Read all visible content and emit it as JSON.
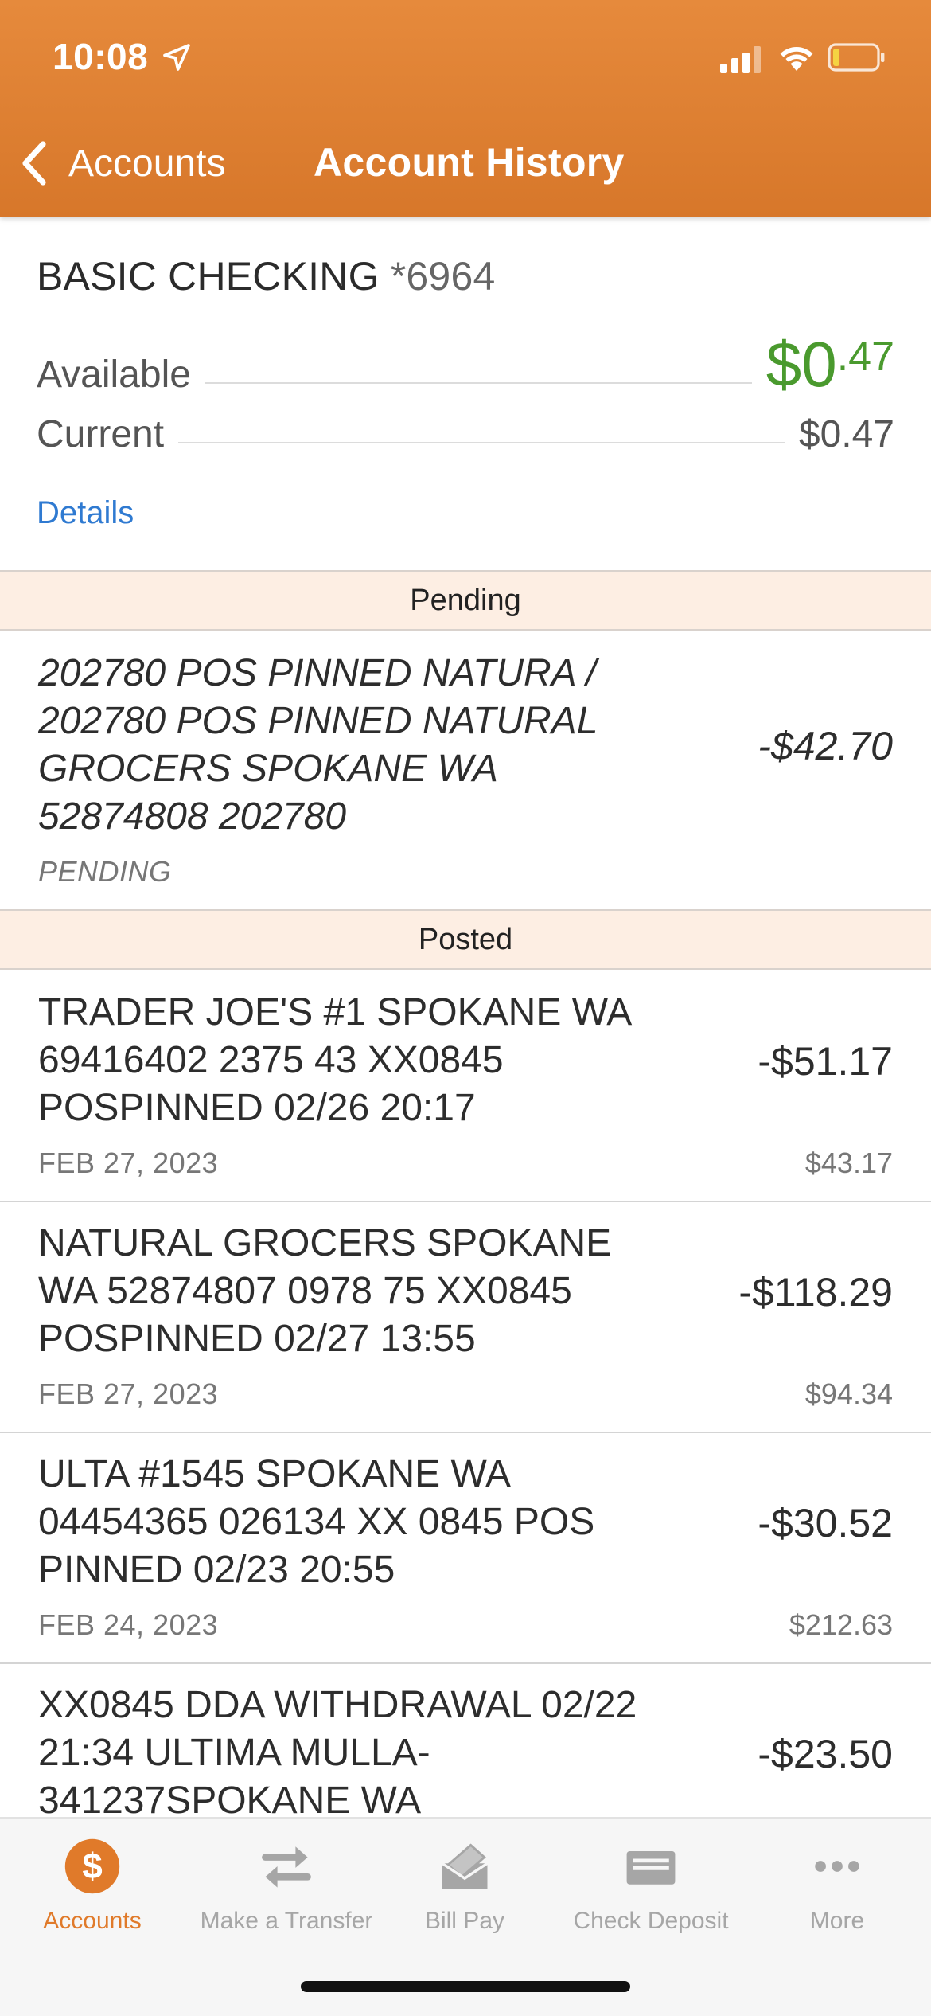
{
  "status_bar": {
    "time": "10:08",
    "icons": [
      "location-arrow-icon",
      "cell-signal-icon",
      "wifi-icon",
      "battery-low-icon"
    ]
  },
  "nav": {
    "back_label": "Accounts",
    "title": "Account History"
  },
  "account": {
    "name": "BASIC CHECKING",
    "suffix": "*6964",
    "available_label": "Available",
    "available_main": "$0",
    "available_cents": ".47",
    "current_label": "Current",
    "current_amount": "$0.47",
    "details_link": "Details"
  },
  "sections": {
    "pending": "Pending",
    "posted": "Posted"
  },
  "pending_transactions": [
    {
      "description": "202780 POS PINNED NATURA / 202780 POS PINNED NATURAL GROCERS SPOKANE WA 52874808 202780",
      "status": "PENDING",
      "amount": "-$42.70"
    }
  ],
  "posted_transactions": [
    {
      "description": "TRADER JOE'S #1 SPOKANE WA 69416402 2375 43 XX0845 POSPINNED 02/26 20:17",
      "date": "FEB 27, 2023",
      "amount": "-$51.17",
      "balance": "$43.17"
    },
    {
      "description": "NATURAL GROCERS SPOKANE WA 52874807 0978 75 XX0845 POSPINNED 02/27 13:55",
      "date": "FEB 27, 2023",
      "amount": "-$118.29",
      "balance": "$94.34"
    },
    {
      "description": "ULTA #1545 SPOKANE WA 04454365 026134 XX 0845 POS PINNED 02/23 20:55",
      "date": "FEB 24, 2023",
      "amount": "-$30.52",
      "balance": "$212.63"
    },
    {
      "description": "XX0845 DDA WITHDRAWAL 02/22 21:34 ULTIMA MULLA-341237SPOKANE WA",
      "date": "",
      "amount": "-$23.50",
      "balance": ""
    }
  ],
  "tabbar": {
    "active": "Accounts",
    "tabs": [
      {
        "label": "Accounts",
        "icon": "dollar-circle-icon"
      },
      {
        "label": "Make a Transfer",
        "icon": "transfer-arrows-icon"
      },
      {
        "label": "Bill Pay",
        "icon": "bill-pay-envelope-icon"
      },
      {
        "label": "Check Deposit",
        "icon": "check-deposit-icon"
      },
      {
        "label": "More",
        "icon": "more-dots-icon"
      }
    ]
  },
  "colors": {
    "header_orange": "#e07a2a",
    "available_green": "#4a9a2e",
    "link_blue": "#2f7ad1",
    "section_bar": "#fdeee3",
    "active_tab": "#e07a2a",
    "inactive_tab": "#a6a6a6"
  }
}
